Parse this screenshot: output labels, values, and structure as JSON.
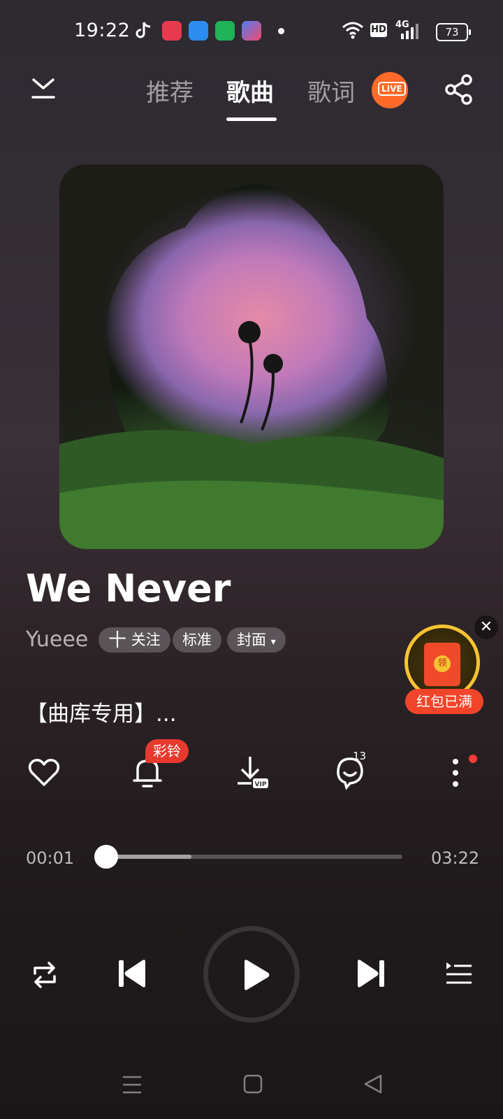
{
  "status_bar": {
    "time": "19:22",
    "battery": "73",
    "network": "4G",
    "hd": "HD"
  },
  "nav": {
    "tabs": [
      {
        "label": "推荐",
        "active": false
      },
      {
        "label": "歌曲",
        "active": true
      },
      {
        "label": "歌词",
        "active": false
      }
    ],
    "live_badge": "LIVE"
  },
  "song": {
    "title": "We Never",
    "artist": "Yueee",
    "follow_label": "关注",
    "quality_label": "标准",
    "cover_label": "封面",
    "description": "【曲库专用】..."
  },
  "red_packet": {
    "label": "红包已满",
    "envelope_char": "领"
  },
  "actions": {
    "ringtone_badge": "彩铃",
    "comment_count": "13"
  },
  "progress": {
    "elapsed": "00:01",
    "total": "03:22",
    "played_fraction": 0.005,
    "buffered_fraction": 0.29
  },
  "icons": [
    "collapse-icon",
    "share-icon",
    "heart-icon",
    "bell-icon",
    "download-vip-icon",
    "comment-icon",
    "more-icon",
    "repeat-icon",
    "previous-icon",
    "play-icon",
    "next-icon",
    "playlist-icon"
  ],
  "colors": {
    "accent_red": "#e8392e",
    "live_orange": "#ff6a2a",
    "packet_gold": "#f7c331"
  }
}
